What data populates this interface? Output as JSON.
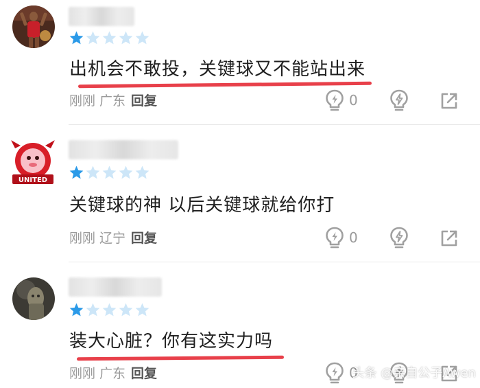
{
  "colors": {
    "star_filled": "#2b9ae8",
    "star_empty": "#cde6f8",
    "underline": "#e8404a",
    "meta_text": "#9a9a9a",
    "icon": "#a0a0a0"
  },
  "comments": [
    {
      "rating": 1,
      "max_rating": 5,
      "text": "出机会不敢投，关键球又不能站出来",
      "time": "刚刚",
      "location": "广东",
      "reply_label": "回复",
      "idea_count": "0",
      "icons": [
        "lightbulb-icon",
        "charge-icon",
        "share-icon"
      ]
    },
    {
      "rating": 1,
      "max_rating": 5,
      "text": "关键球的神 以后关键球就给你打",
      "time": "刚刚",
      "location": "辽宁",
      "reply_label": "回复",
      "idea_count": "0",
      "icons": [
        "lightbulb-icon",
        "charge-icon",
        "share-icon"
      ]
    },
    {
      "rating": 1,
      "max_rating": 5,
      "text": "装大心脏？你有这实力吗",
      "time": "刚刚",
      "location": "广东",
      "reply_label": "回复",
      "idea_count": "0",
      "icons": [
        "lightbulb-icon",
        "charge-icon",
        "share-icon"
      ]
    }
  ],
  "watermark": "头条 @亲自公子Awen"
}
